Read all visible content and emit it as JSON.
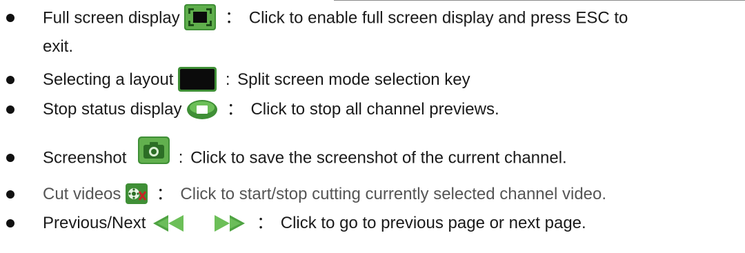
{
  "items": [
    {
      "title": "Full screen display",
      "icon": "fullscreen-icon",
      "sep": "：",
      "desc": "Click to enable full screen display and press ESC to",
      "desc2": "exit."
    },
    {
      "title": "Selecting a layout",
      "icon": "layout-icon",
      "sep": ":",
      "desc": "Split screen mode selection key"
    },
    {
      "title": "Stop status display",
      "icon": "stop-preview-icon",
      "sep": "：",
      "desc": "Click to stop all channel previews."
    },
    {
      "title": "Screenshot",
      "icon": "camera-icon",
      "sep": ":",
      "desc": "Click to save the screenshot of the current channel."
    },
    {
      "title": "Cut videos",
      "icon": "video-cut-icon",
      "sep": "：",
      "desc": "Click to start/stop cutting currently selected channel video."
    },
    {
      "title": "Previous/Next",
      "icon": "prev-next-icons",
      "sep": "：",
      "desc": "Click to go to previous page or next page."
    }
  ],
  "colors": {
    "icon_green": "#3f8f36",
    "icon_dark": "#0b0b0b",
    "muted_text": "#555555"
  }
}
